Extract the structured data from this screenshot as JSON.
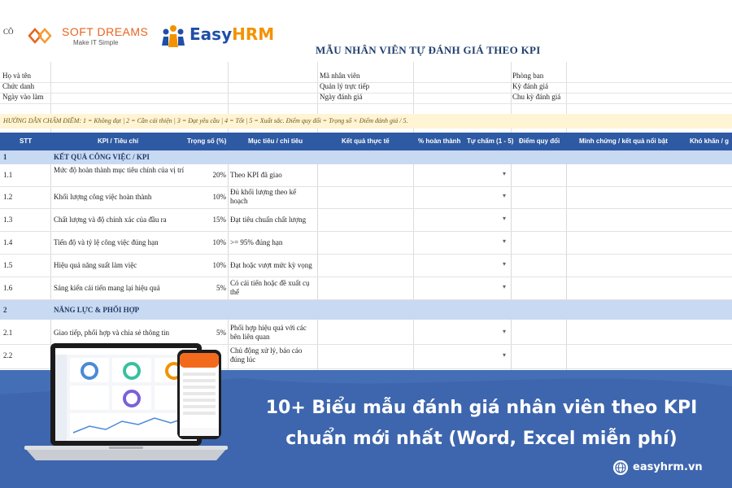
{
  "corner_text": "CÔ",
  "softdreams": {
    "name": "SOFT DREAMS",
    "tagline": "Make IT Simple"
  },
  "easyhrm": {
    "name_part1": "Easy",
    "name_part2": "HRM"
  },
  "form_title": "MẪU NHÂN VIÊN TỰ ĐÁNH GIÁ THEO KPI",
  "info_rows": [
    {
      "label1": "Họ và tên",
      "label2": "Mã nhân viên",
      "label3": "Phòng ban"
    },
    {
      "label1": "Chức danh",
      "label2": "Quản lý trực tiếp",
      "label3": "Kỳ đánh giá"
    },
    {
      "label1": "Ngày vào làm",
      "label2": "Ngày đánh giá",
      "label3": "Chu kỳ đánh giá"
    }
  ],
  "guide_text": "HƯỚNG DẪN CHẤM ĐIỂM: 1 = Không đạt | 2 = Cần cải thiện | 3 = Đạt yêu cầu | 4 = Tốt | 5 = Xuất sắc. Điểm quy đổi = Trọng số × Điểm đánh giá / 5.",
  "columns": {
    "stt": "STT",
    "kpi": "KPI / Tiêu chí",
    "weight": "Trọng số (%)",
    "target": "Mục tiêu / chỉ tiêu",
    "result": "Kết quả thực tế",
    "percent": "% hoàn thành",
    "self_score": "Tự chấm (1 - 5)",
    "converted": "Điểm quy đổi",
    "evidence": "Minh chứng / kết quả nổi bật",
    "difficulty": "Khó khăn / g"
  },
  "sections": [
    {
      "no": "1",
      "title": "KẾT QUẢ CÔNG VIỆC / KPI",
      "rows": [
        {
          "stt": "1.1",
          "kpi": "Mức độ hoàn thành mục tiêu chính của vị trí",
          "weight": "20%",
          "target": "Theo KPI đã giao"
        },
        {
          "stt": "1.2",
          "kpi": "Khối lượng công việc hoàn thành",
          "weight": "10%",
          "target": "Đủ khối lượng theo kế hoạch"
        },
        {
          "stt": "1.3",
          "kpi": "Chất lượng và độ chính xác của đầu ra",
          "weight": "15%",
          "target": "Đạt tiêu chuẩn chất lượng"
        },
        {
          "stt": "1.4",
          "kpi": "Tiến độ và tỷ lệ công việc đúng hạn",
          "weight": "10%",
          "target": ">= 95% đúng hạn"
        },
        {
          "stt": "1.5",
          "kpi": "Hiệu quả năng suất làm việc",
          "weight": "10%",
          "target": "Đạt hoặc vượt mức kỳ vọng"
        },
        {
          "stt": "1.6",
          "kpi": "Sáng kiến cải tiến mang lại hiệu quả",
          "weight": "5%",
          "target": "Có cải tiến hoặc đề xuất cụ thể"
        }
      ]
    },
    {
      "no": "2",
      "title": "NĂNG LỰC & PHỐI HỢP",
      "rows": [
        {
          "stt": "2.1",
          "kpi": "Giao tiếp, phối hợp và chia sẻ thông tin",
          "weight": "5%",
          "target": "Phối hợp hiệu quả với các bên liên quan"
        },
        {
          "stt": "2.2",
          "kpi": "",
          "weight": "",
          "target": "Chủ động xử lý, báo cáo đúng lúc"
        }
      ]
    }
  ],
  "dropdown_marker": "▾",
  "banner": {
    "headline_line1": "10+ Biểu mẫu đánh giá nhân viên theo KPI",
    "headline_line2": "chuẩn mới nhất (Word, Excel miễn phí)",
    "site": "easyhrm.vn"
  },
  "colors": {
    "header_blue": "#2e5aa3",
    "section_blue": "#c8d9f2",
    "banner_blue": "#3e66ae",
    "orange": "#f39200"
  }
}
